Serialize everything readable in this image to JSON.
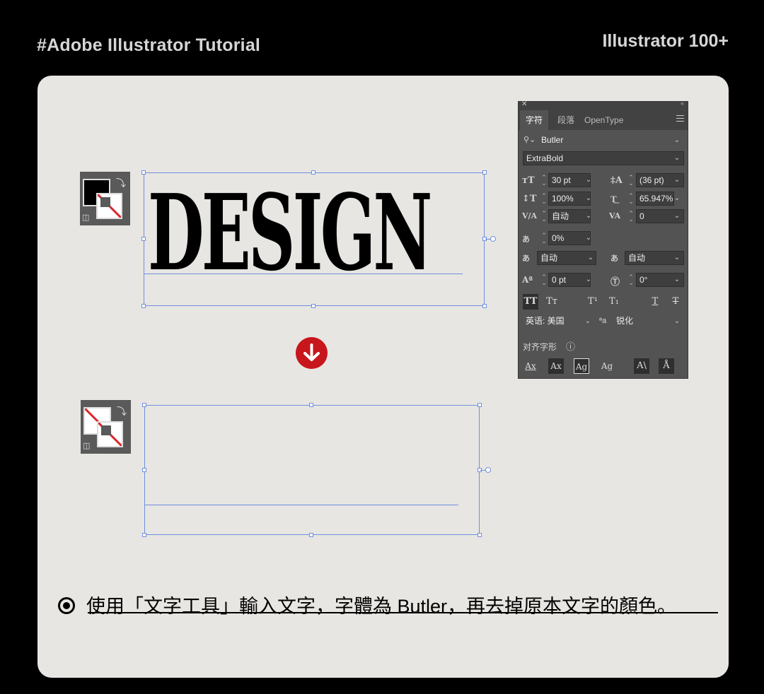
{
  "header": {
    "left_title": "#Adobe Illustrator Tutorial",
    "right_title": "Illustrator 100+"
  },
  "artboard": {
    "sample_text": "DESIGN"
  },
  "character_panel": {
    "tabs": [
      "字符",
      "段落",
      "OpenType"
    ],
    "font_family": "Butler",
    "font_style": "ExtraBold",
    "font_size": "30 pt",
    "leading": "(36 pt)",
    "vertical_scale": "100%",
    "horizontal_scale": "65.947%",
    "kerning": "自动",
    "tracking": "0",
    "tsume": "0%",
    "aki_left": "自动",
    "aki_right": "自动",
    "baseline_shift": "0 pt",
    "rotation": "0°",
    "language": "英语: 美国",
    "anti_alias": "锐化",
    "align_glyph_label": "对齐字形"
  },
  "caption": {
    "text": "使用「文字工具」輸入文字，字體為 Butler，再去掉原本文字的顏色。"
  },
  "colors": {
    "accent_red": "#c8161d",
    "selection_blue": "#6f8fe0",
    "card_bg": "#e8e6e2"
  }
}
